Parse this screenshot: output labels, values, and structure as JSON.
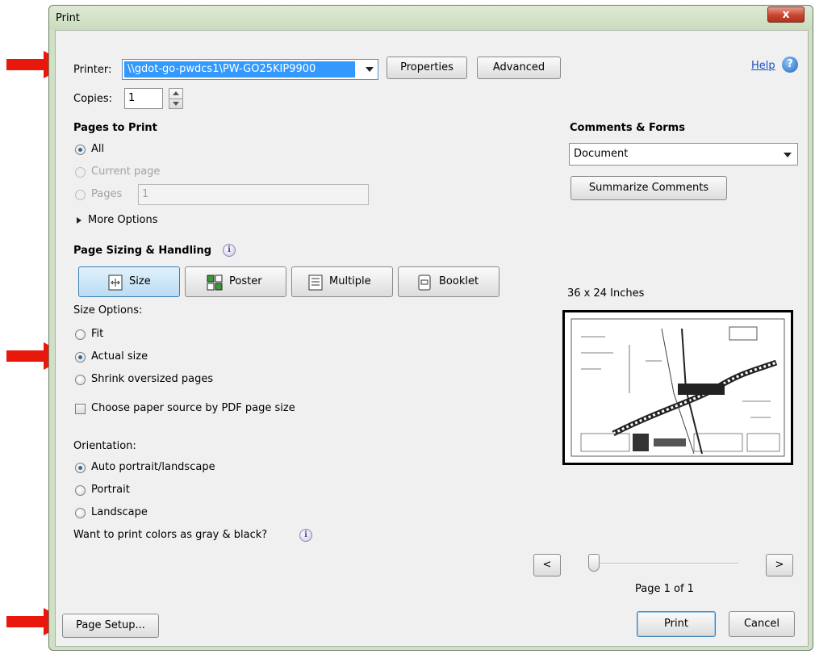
{
  "window": {
    "title": "Print",
    "close_glyph": "x"
  },
  "printer": {
    "label": "Printer:",
    "value": "\\\\gdot-go-pwdcs1\\PW-GO25KIP9900",
    "properties_label": "Properties",
    "advanced_label": "Advanced"
  },
  "help": {
    "label": "Help"
  },
  "copies": {
    "label": "Copies:",
    "value": "1"
  },
  "pages_to_print": {
    "heading": "Pages to Print",
    "all": "All",
    "current_page": "Current page",
    "pages": "Pages",
    "pages_value": "1",
    "more_options": "More Options"
  },
  "comments": {
    "heading": "Comments & Forms",
    "value": "Document",
    "summarize_label": "Summarize Comments"
  },
  "sizing": {
    "heading": "Page Sizing & Handling",
    "tabs": [
      "Size",
      "Poster",
      "Multiple",
      "Booklet"
    ],
    "size_options_label": "Size Options:",
    "fit": "Fit",
    "actual_size": "Actual size",
    "shrink": "Shrink oversized pages",
    "choose_source": "Choose paper source by PDF page size"
  },
  "orientation": {
    "label": "Orientation:",
    "auto": "Auto portrait/landscape",
    "portrait": "Portrait",
    "landscape": "Landscape",
    "gray_question": "Want to print colors as gray & black?"
  },
  "preview": {
    "size_label": "36 x 24 Inches",
    "prev": "<",
    "next": ">",
    "page_label": "Page 1 of 1"
  },
  "footer": {
    "page_setup": "Page Setup...",
    "print": "Print",
    "cancel": "Cancel"
  },
  "colors": {
    "accent": "#3399ff",
    "arrow": "#e8180c"
  }
}
